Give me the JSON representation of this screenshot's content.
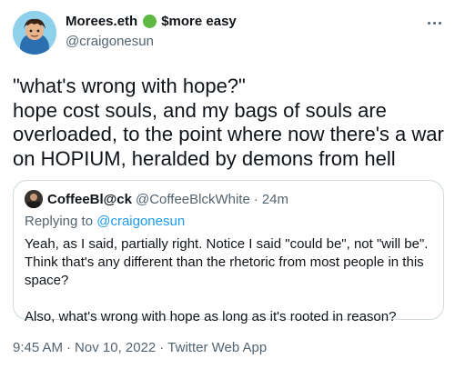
{
  "author": {
    "display_name": "Morees.eth",
    "name_suffix": "$more easy",
    "handle": "@craigonesun",
    "accent_color": "#5fb843"
  },
  "tweet": {
    "text_lines": [
      "\"what's wrong with hope?\"",
      "hope cost souls, and my bags of souls are",
      "overloaded, to the point where now there's a war",
      "on HOPIUM, heralded by demons from hell"
    ]
  },
  "quote": {
    "name": "CoffeeBl@ck",
    "handle": "@CoffeeBlckWhite",
    "dot": "·",
    "time": "24m",
    "replying_prefix": "Replying to",
    "replying_handle": "@craigonesun",
    "body_lines": [
      "Yeah, as I said, partially right. Notice I said \"could be\", not \"will be\".",
      "Think that's any different than the rhetoric from most people in this",
      "space?",
      "",
      "Also, what's wrong with hope as long as it's rooted in reason?"
    ]
  },
  "footer": {
    "time": "9:45 AM",
    "sep1": "·",
    "date": "Nov 10, 2022",
    "sep2": "·",
    "source": "Twitter Web App"
  },
  "icons": {
    "more": "more-horizontal-icon",
    "status": "green-circle-emoji"
  },
  "colors": {
    "secondary_text": "#536471",
    "link": "#1d9bf0",
    "border": "#cfd9de"
  }
}
